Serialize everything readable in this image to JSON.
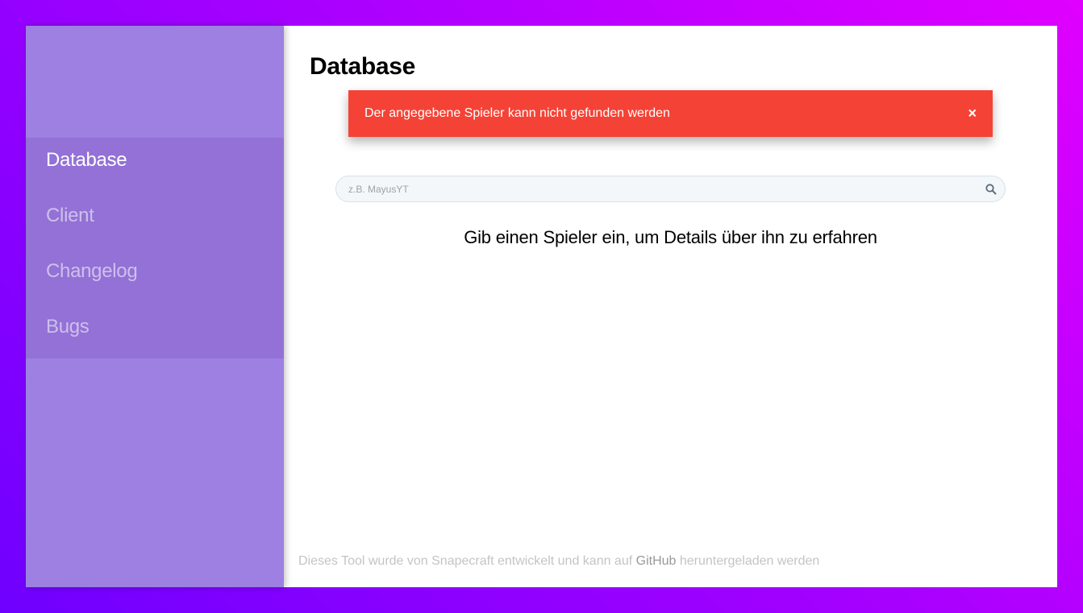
{
  "sidebar": {
    "items": [
      {
        "label": "Database",
        "active": true
      },
      {
        "label": "Client",
        "active": false
      },
      {
        "label": "Changelog",
        "active": false
      },
      {
        "label": "Bugs",
        "active": false
      }
    ]
  },
  "main": {
    "title": "Database",
    "alert": {
      "message": "Der angegebene Spieler kann nicht gefunden werden",
      "close_symbol": "×",
      "color": "#f44336"
    },
    "search": {
      "placeholder": "z.B. MayusYT",
      "value": "",
      "icon": "search-icon"
    },
    "info_text": "Gib einen Spieler ein, um Details über ihn zu erfahren"
  },
  "footer": {
    "text_before": "Dieses Tool wurde von Snapecraft entwickelt und kann auf ",
    "link_label": "GitHub",
    "text_after": " heruntergeladen werden"
  },
  "colors": {
    "sidebar_bg": "#9d80e2",
    "nav_bg": "#9371d6",
    "background_gradient_start": "#6f00ff",
    "background_gradient_end": "#e000ff"
  }
}
